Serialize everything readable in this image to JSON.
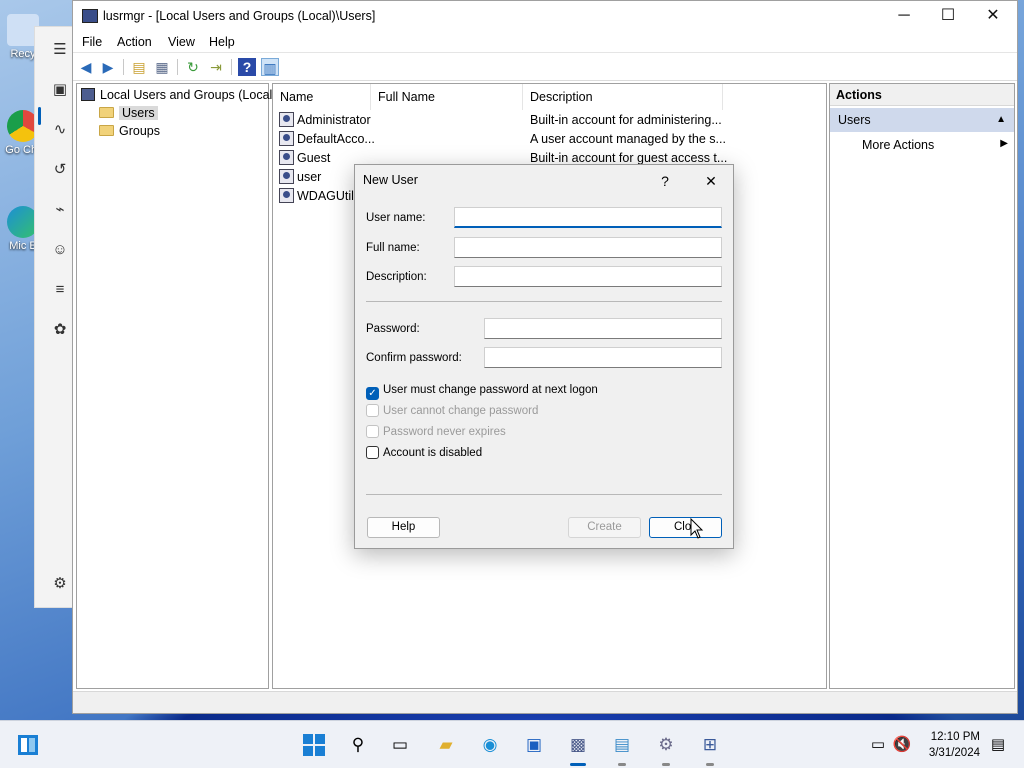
{
  "desktop": {
    "icons": [
      {
        "label": "Recy",
        "color": "#2d7bd4"
      },
      {
        "label": "Go Chr",
        "color": "#e0483e"
      },
      {
        "label": "Mic E",
        "color": "#1c8fd6"
      }
    ]
  },
  "window": {
    "title": "lusrmgr - [Local Users and Groups (Local)\\Users]",
    "minimize": "─",
    "maximize": "☐",
    "close": "✕"
  },
  "menu": {
    "items": [
      "File",
      "Action",
      "View",
      "Help"
    ]
  },
  "tree": {
    "root": "Local Users and Groups (Local)",
    "children": [
      "Users",
      "Groups"
    ]
  },
  "list": {
    "columns": [
      "Name",
      "Full Name",
      "Description"
    ],
    "rows": [
      {
        "name": "Administrator",
        "full_name": "",
        "description": "Built-in account for administering..."
      },
      {
        "name": "DefaultAcco...",
        "full_name": "",
        "description": "A user account managed by the s..."
      },
      {
        "name": "Guest",
        "full_name": "",
        "description": "Built-in account for guest access t..."
      },
      {
        "name": "user",
        "full_name": "",
        "description": ""
      },
      {
        "name": "WDAGUtilit",
        "full_name": "",
        "description": ""
      }
    ]
  },
  "actions": {
    "header": "Actions",
    "section": "Users",
    "item": "More Actions"
  },
  "dialog": {
    "title": "New User",
    "help_glyph": "?",
    "close_glyph": "✕",
    "fields": {
      "username_label": "User name:",
      "username_value": "",
      "fullname_label": "Full name:",
      "fullname_value": "",
      "description_label": "Description:",
      "description_value": "",
      "password_label": "Password:",
      "password_value": "",
      "confirm_label": "Confirm password:",
      "confirm_value": ""
    },
    "checkboxes": [
      {
        "label": "User must change password at next logon",
        "checked": true,
        "enabled": true
      },
      {
        "label": "User cannot change password",
        "checked": false,
        "enabled": false
      },
      {
        "label": "Password never expires",
        "checked": false,
        "enabled": false
      },
      {
        "label": "Account is disabled",
        "checked": false,
        "enabled": true
      }
    ],
    "buttons": {
      "help": "Help",
      "create": "Create",
      "close": "Clos"
    }
  },
  "taskbar": {
    "time": "12:10 PM",
    "date": "3/31/2024"
  },
  "colors": {
    "accent": "#005fb8",
    "selection": "#cfd9ec"
  }
}
